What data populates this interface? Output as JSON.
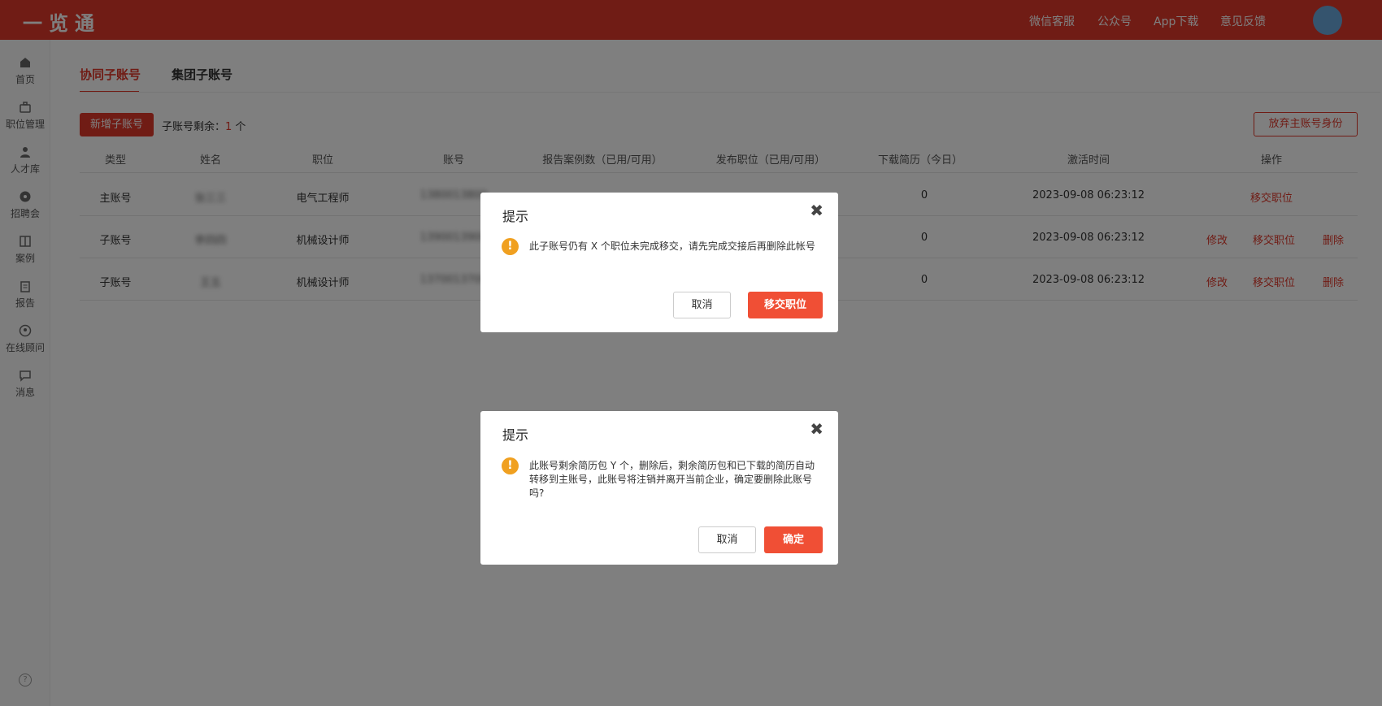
{
  "app": {
    "logo": "一览通"
  },
  "topnav": [
    "微信客服",
    "公众号",
    "App下载",
    "意见反馈"
  ],
  "sidebar": [
    {
      "label": "首页",
      "icon": "home-icon"
    },
    {
      "label": "职位管理",
      "icon": "briefcase-icon"
    },
    {
      "label": "人才库",
      "icon": "person-icon"
    },
    {
      "label": "招聘会",
      "icon": "fair-icon"
    },
    {
      "label": "案例",
      "icon": "book-icon"
    },
    {
      "label": "报告",
      "icon": "clipboard-icon"
    },
    {
      "label": "在线顾问",
      "icon": "consultant-icon"
    },
    {
      "label": "消息",
      "icon": "message-icon"
    }
  ],
  "tabs": [
    "协同子账号",
    "集团子账号"
  ],
  "toolbar": {
    "add_label": "新增子账号",
    "remain_label": "子账号剩余：",
    "remain_count": "1",
    "remain_unit": " 个",
    "abandon_label": "放弃主账号身份"
  },
  "table": {
    "headers": [
      "类型",
      "姓名",
      "职位",
      "账号",
      "报告案例数（已用/可用）",
      "发布职位（已用/可用）",
      "下载简历（今日）",
      "激活时间",
      "操作"
    ],
    "rows": [
      {
        "type": "主账号",
        "name": "张三三",
        "position": "电气工程师",
        "account": "1380013800",
        "download": "0",
        "time": "2023-09-08 06:23:12",
        "ops": [
          "移交职位"
        ]
      },
      {
        "type": "子账号",
        "name": "李四四",
        "position": "机械设计师",
        "account": "1390013900",
        "download": "0",
        "time": "2023-09-08 06:23:12",
        "ops": [
          "修改",
          "移交职位",
          "删除"
        ]
      },
      {
        "type": "子账号",
        "name": "王五",
        "position": "机械设计师",
        "account": "1370013700",
        "download": "0",
        "time": "2023-09-08 06:23:12",
        "ops": [
          "修改",
          "移交职位",
          "删除"
        ]
      }
    ]
  },
  "dialog1": {
    "title": "提示",
    "message": "此子账号仍有 X 个职位未完成移交，请先完成交接后再删除此帐号",
    "cancel": "取消",
    "confirm": "移交职位"
  },
  "dialog2": {
    "title": "提示",
    "message": "此账号剩余简历包 Y 个，删除后，剩余简历包和已下载的简历自动转移到主账号，此账号将注销并离开当前企业，确定要删除此账号吗?",
    "cancel": "取消",
    "confirm": "确定"
  },
  "colors": {
    "brand": "#e0382b",
    "primary_button": "#f04f35",
    "warning": "#f0a020"
  }
}
